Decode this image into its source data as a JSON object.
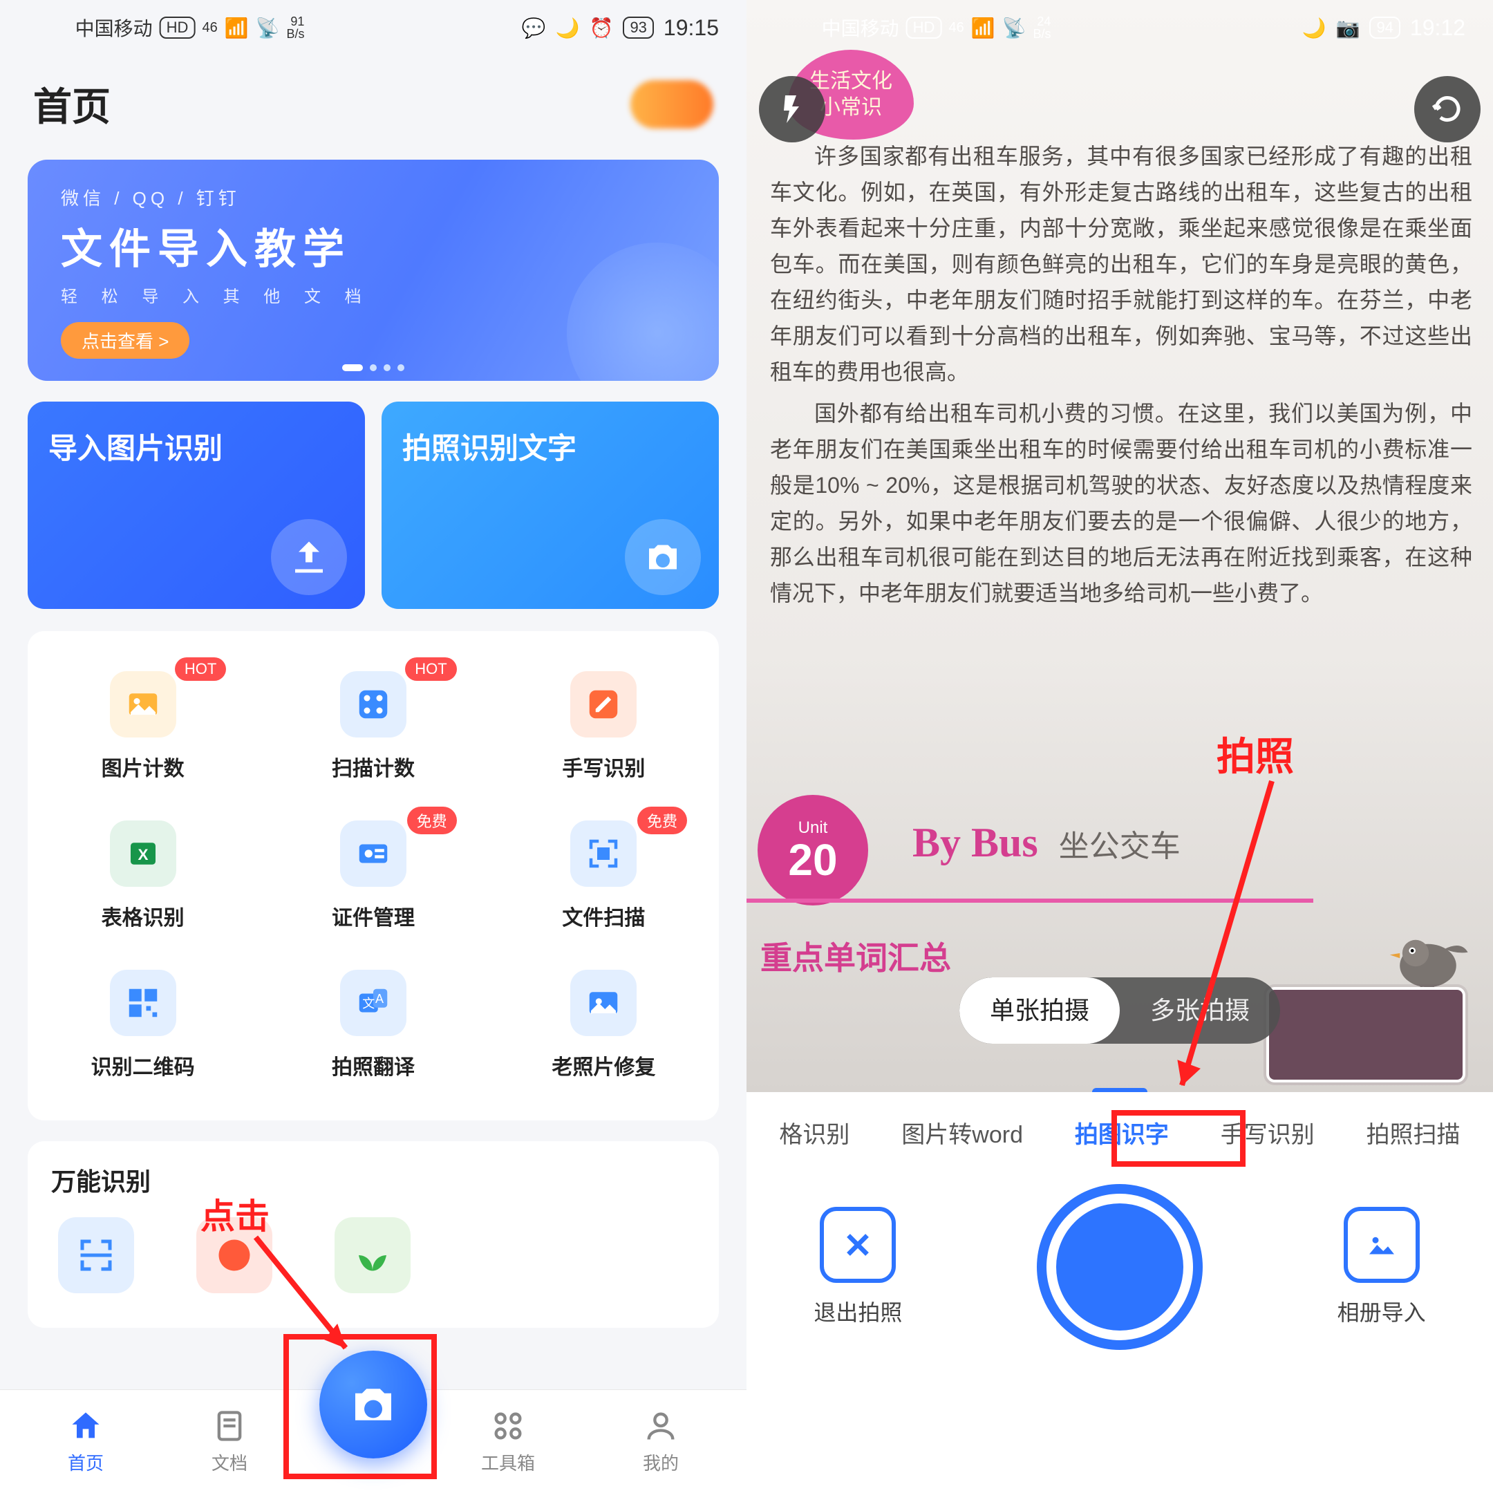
{
  "left": {
    "statusbar": {
      "carrier": "中国移动",
      "hd": "HD",
      "net": "46",
      "speed_top": "91",
      "speed_bot": "B/s",
      "battery": "93",
      "time": "19:15"
    },
    "header": {
      "title": "首页"
    },
    "banner": {
      "line1": "微信  /  QQ  /  钉钉",
      "line2": "文件导入教学",
      "line3": "轻 松 导 入 其 他 文 档",
      "cta": "点击查看 >"
    },
    "cards": {
      "a": "导入图片识别",
      "b": "拍照识别文字"
    },
    "grid": [
      {
        "label": "图片计数",
        "color": "#ffb53a",
        "badge": "HOT"
      },
      {
        "label": "扫描计数",
        "color": "#3a8bff",
        "badge": "HOT"
      },
      {
        "label": "手写识别",
        "color": "#ff6a3a",
        "badge": ""
      },
      {
        "label": "表格识别",
        "color": "#17954a",
        "badge": ""
      },
      {
        "label": "证件管理",
        "color": "#3a8bff",
        "badge": "免费"
      },
      {
        "label": "文件扫描",
        "color": "#3a8bff",
        "badge": "免费"
      },
      {
        "label": "识别二维码",
        "color": "#3a8bff",
        "badge": ""
      },
      {
        "label": "拍照翻译",
        "color": "#3a8bff",
        "badge": ""
      },
      {
        "label": "老照片修复",
        "color": "#3a8bff",
        "badge": ""
      }
    ],
    "section2": {
      "title": "万能识别"
    },
    "tabs": {
      "home": "首页",
      "doc": "文档",
      "tools": "工具箱",
      "me": "我的"
    },
    "annotation": "点击"
  },
  "right": {
    "statusbar": {
      "carrier": "中国移动",
      "hd": "HD",
      "net": "46",
      "speed_top": "24",
      "speed_bot": "B/s",
      "battery": "94",
      "time": "19:12"
    },
    "bubble_l1": "生活文化",
    "bubble_l2": "小常识",
    "paragraph1": "许多国家都有出租车服务，其中有很多国家已经形成了有趣的出租车文化。例如，在英国，有外形走复古路线的出租车，这些复古的出租车外表看起来十分庄重，内部十分宽敞，乘坐起来感觉很像是在乘坐面包车。而在美国，则有颜色鲜亮的出租车，它们的车身是亮眼的黄色，在纽约街头，中老年朋友们随时招手就能打到这样的车。在芬兰，中老年朋友们可以看到十分高档的出租车，例如奔驰、宝马等，不过这些出租车的费用也很高。",
    "paragraph2": "国外都有给出租车司机小费的习惯。在这里，我们以美国为例，中老年朋友们在美国乘坐出租车的时候需要付给出租车司机的小费标准一般是10% ~ 20%，这是根据司机驾驶的状态、友好态度以及热情程度来定的。另外，如果中老年朋友们要去的是一个很偏僻、人很少的地方，那么出租车司机很可能在到达目的地后无法再在附近找到乘客，在这种情况下，中老年朋友们就要适当地多给司机一些小费了。",
    "unit_label": "Unit",
    "unit_num": "20",
    "lesson_en": "By Bus",
    "lesson_cn": "坐公交车",
    "vocab": "重点单词汇总",
    "mode_single": "单张拍摄",
    "mode_multi": "多张拍摄",
    "modes": [
      "格识别",
      "图片转word",
      "拍图识字",
      "手写识别",
      "拍照扫描"
    ],
    "active_mode_index": 2,
    "exit": "退出拍照",
    "import": "相册导入",
    "annotation": "拍照"
  }
}
